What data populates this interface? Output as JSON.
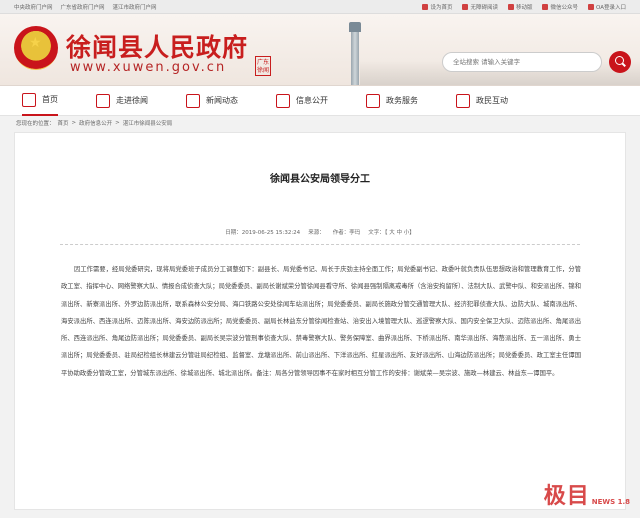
{
  "topbar": {
    "links": [
      "中央政府门户网",
      "广东省政府门户网",
      "湛江市政府门户网"
    ],
    "tools": [
      "设为首页",
      "无障碍阅读",
      "移动版",
      "微信公众号",
      "OA登录入口"
    ]
  },
  "header": {
    "title": "徐闻县人民政府",
    "url": "www.xuwen.gov.cn",
    "seal_text": "广东徐闻",
    "search_placeholder": "全站搜索 请输入关键字"
  },
  "nav": {
    "items": [
      {
        "label": "首页",
        "icon": "home-icon"
      },
      {
        "label": "走进徐闻",
        "icon": "scroll-icon"
      },
      {
        "label": "新闻动态",
        "icon": "book-icon"
      },
      {
        "label": "信息公开",
        "icon": "document-icon"
      },
      {
        "label": "政务服务",
        "icon": "heart-icon"
      },
      {
        "label": "政民互动",
        "icon": "chat-icon"
      }
    ]
  },
  "breadcrumb": {
    "prefix": "您现在的位置：",
    "items": [
      "首页",
      "政府信息公开",
      "湛江市徐闻县公安局"
    ]
  },
  "article": {
    "title": "徐闻县公安局领导分工",
    "date": "日期：2019-06-25 15:32:24",
    "source": "来源：",
    "author": "作者：李玛",
    "font_size": "文字：【 大 中 小】",
    "body": "因工作需要，经局党委研究，现将局党委班子成员分工调整如下：副县长、局党委书记、局长于庆劲主持全面工作；局党委副书记、政委叶就负责队伍思想政治和管理教育工作，分管政工室、指挥中心、网络警察大队、情报合成侦查大队；局党委委员、副局长谢斌荣分管徐闻县看守所、徐闻县强制隔离戒毒所（含治安拘留所）、法制大队、武警中队、和安派出所、锦和派出所、新寮派出所、外罗边防派出所，联系森林公安分局、海口铁路公安处徐闻车站派出所；局党委委员、副局长施政分管交通管理大队、经济犯罪侦查大队、边防大队、城南派出所、海安派出所、西连派出所、迈陈派出所、海安边防派出所；局党委委员、副局长林益东分管徐闻检查站、治安出入境管理大队、巡逻警察大队、国内安全保卫大队、迈陈派出所、角尾派出所、西连派出所、角尾边防派出所；局党委委员、副局长吴宗波分管刑事侦查大队、禁毒警察大队、警务保障室、曲界派出所、下桥派出所、南华派出所、海嶅派出所、五一派出所、勇士派出所；局党委委员、驻局纪检组长林建云分管驻局纪检组、监督室、龙塘派出所、前山派出所、下洋派出所、红星派出所、友好派出所、山海边防派出所；局党委委员、政工室主任谭国平协助政委分管政工室，分管城东派出所、徐城派出所、城北派出所。备注：局各分管领导因事不在家时相互分管工作的安排：谢斌荣—吴宗波、施政—林建云、林益东—谭国平。"
  },
  "watermark": {
    "main": "极目",
    "sub": "NEWS 1.8"
  },
  "colors": {
    "brand_red": "#c9141b",
    "title_red": "#c81e1e"
  }
}
